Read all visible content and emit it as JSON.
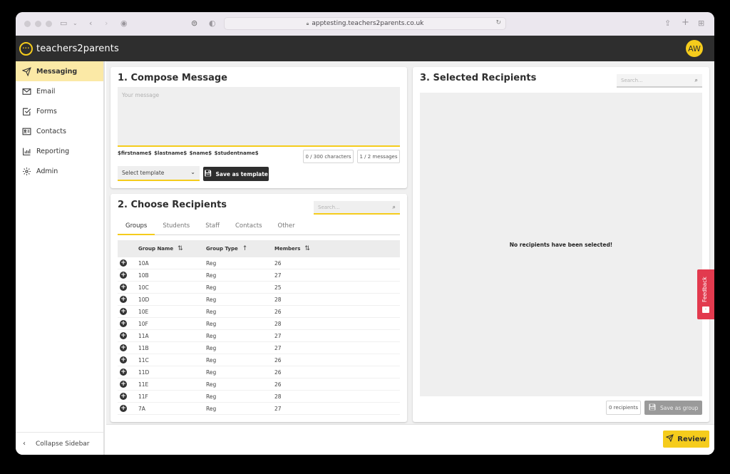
{
  "browser": {
    "url": "apptesting.teachers2parents.co.uk",
    "icons": [
      "sidebar-toggle-icon",
      "back-icon",
      "forward-icon",
      "site-icon",
      "privacy-icon",
      "shield-icon",
      "reload-icon",
      "share-icon",
      "new-tab-icon",
      "tab-overview-icon"
    ]
  },
  "app": {
    "brand": "teachers2parents",
    "logo_glyph": "···",
    "avatar_initials": "AW"
  },
  "sidebar": {
    "items": [
      {
        "label": "Messaging",
        "icon": "send-icon",
        "active": true
      },
      {
        "label": "Email",
        "icon": "envelope-icon",
        "active": false
      },
      {
        "label": "Forms",
        "icon": "checkbox-icon",
        "active": false
      },
      {
        "label": "Contacts",
        "icon": "contact-card-icon",
        "active": false
      },
      {
        "label": "Reporting",
        "icon": "bar-chart-icon",
        "active": false
      },
      {
        "label": "Admin",
        "icon": "gear-icon",
        "active": false
      }
    ],
    "collapse_label": "Collapse Sidebar"
  },
  "compose": {
    "title": "1. Compose Message",
    "message_placeholder": "Your message",
    "message_value": "",
    "placeholders_text": "$firstname$  $lastname$  $name$  $studentname$",
    "char_count": "0 / 300 characters",
    "message_count": "1 / 2 messages",
    "template_select": "Select template",
    "save_template_label": "Save as template"
  },
  "recipients": {
    "title": "2. Choose Recipients",
    "search_placeholder": "Search...",
    "tabs": [
      {
        "label": "Groups",
        "active": true
      },
      {
        "label": "Students",
        "active": false
      },
      {
        "label": "Staff",
        "active": false
      },
      {
        "label": "Contacts",
        "active": false
      },
      {
        "label": "Other",
        "active": false
      }
    ],
    "columns": [
      "Group Name",
      "Group Type",
      "Members"
    ],
    "rows": [
      [
        "10A",
        "Reg",
        "26"
      ],
      [
        "10B",
        "Reg",
        "27"
      ],
      [
        "10C",
        "Reg",
        "25"
      ],
      [
        "10D",
        "Reg",
        "28"
      ],
      [
        "10E",
        "Reg",
        "26"
      ],
      [
        "10F",
        "Reg",
        "28"
      ],
      [
        "11A",
        "Reg",
        "27"
      ],
      [
        "11B",
        "Reg",
        "27"
      ],
      [
        "11C",
        "Reg",
        "26"
      ],
      [
        "11D",
        "Reg",
        "26"
      ],
      [
        "11E",
        "Reg",
        "26"
      ],
      [
        "11F",
        "Reg",
        "28"
      ],
      [
        "7A",
        "Reg",
        "27"
      ]
    ]
  },
  "selected": {
    "title": "3. Selected Recipients",
    "search_placeholder": "Search...",
    "empty_message": "No recipients have been selected!",
    "count_label": "0 recipients",
    "save_group_label": "Save as group"
  },
  "footer": {
    "review_label": "Review"
  },
  "feedback": {
    "label": "Feedback"
  },
  "colors": {
    "accent": "#f5cc1c",
    "header": "#2e2e2e",
    "feedback": "#e23a4e",
    "active_nav": "#fbe9a6"
  }
}
